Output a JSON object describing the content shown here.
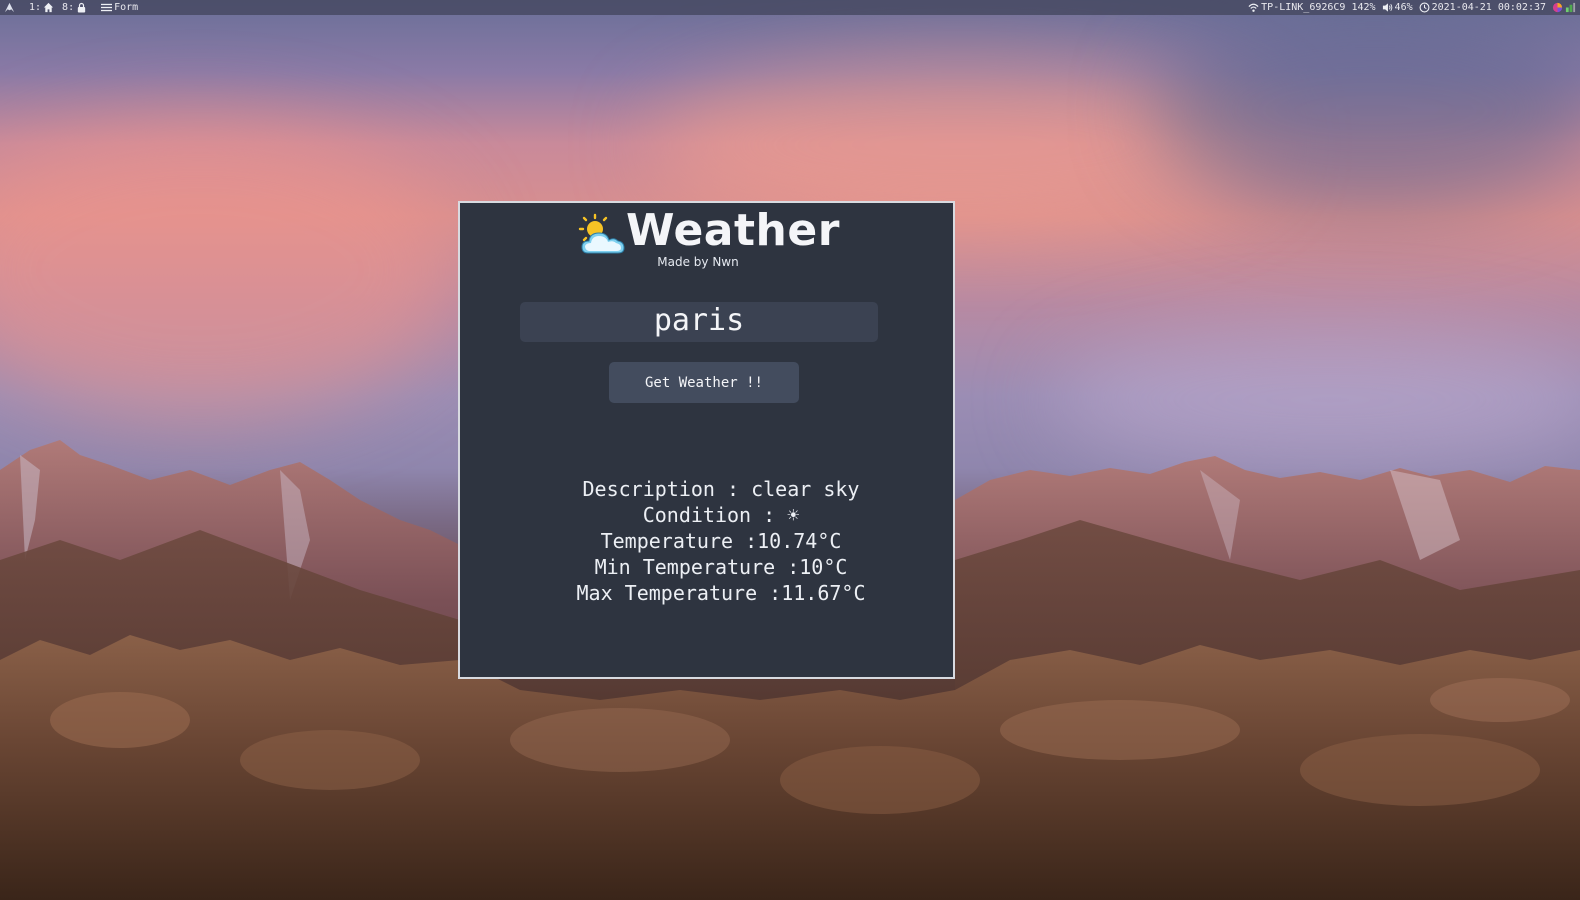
{
  "topbar": {
    "left": {
      "workspace_1": "1:",
      "workspace_8": "8:",
      "active_window": "Form"
    },
    "right": {
      "wifi": "TP-LINK_6926C9 142%",
      "volume": "46%",
      "datetime": "2021-04-21 00:02:37"
    }
  },
  "app": {
    "title": "Weather",
    "subtitle": "Made by Nwn",
    "city_input": {
      "value": "paris",
      "placeholder": ""
    },
    "button_label": "Get Weather !!",
    "results": {
      "description": "Description : clear sky",
      "condition": "Condition : ☀",
      "temperature": "Temperature :10.74°C",
      "min_temperature": "Min Temperature :10°C",
      "max_temperature": "Max Temperature :11.67°C"
    }
  },
  "colors": {
    "window_bg": "#2e3440",
    "input_bg": "#3b4252",
    "button_bg": "#434c5e",
    "text": "#eceff4",
    "topbar_bg": "#464860"
  },
  "icons": {
    "arch_logo": "arch-linux-icon",
    "workspace_1": "home-icon",
    "workspace_8": "lock-icon",
    "active_window": "menu-icon",
    "wifi": "wifi-icon",
    "volume": "speaker-icon",
    "clock": "clock-icon",
    "tray_1": "colorful-tray-icon",
    "tray_2": "network-tray-icon",
    "weather_logo": "sun-cloud-icon"
  }
}
